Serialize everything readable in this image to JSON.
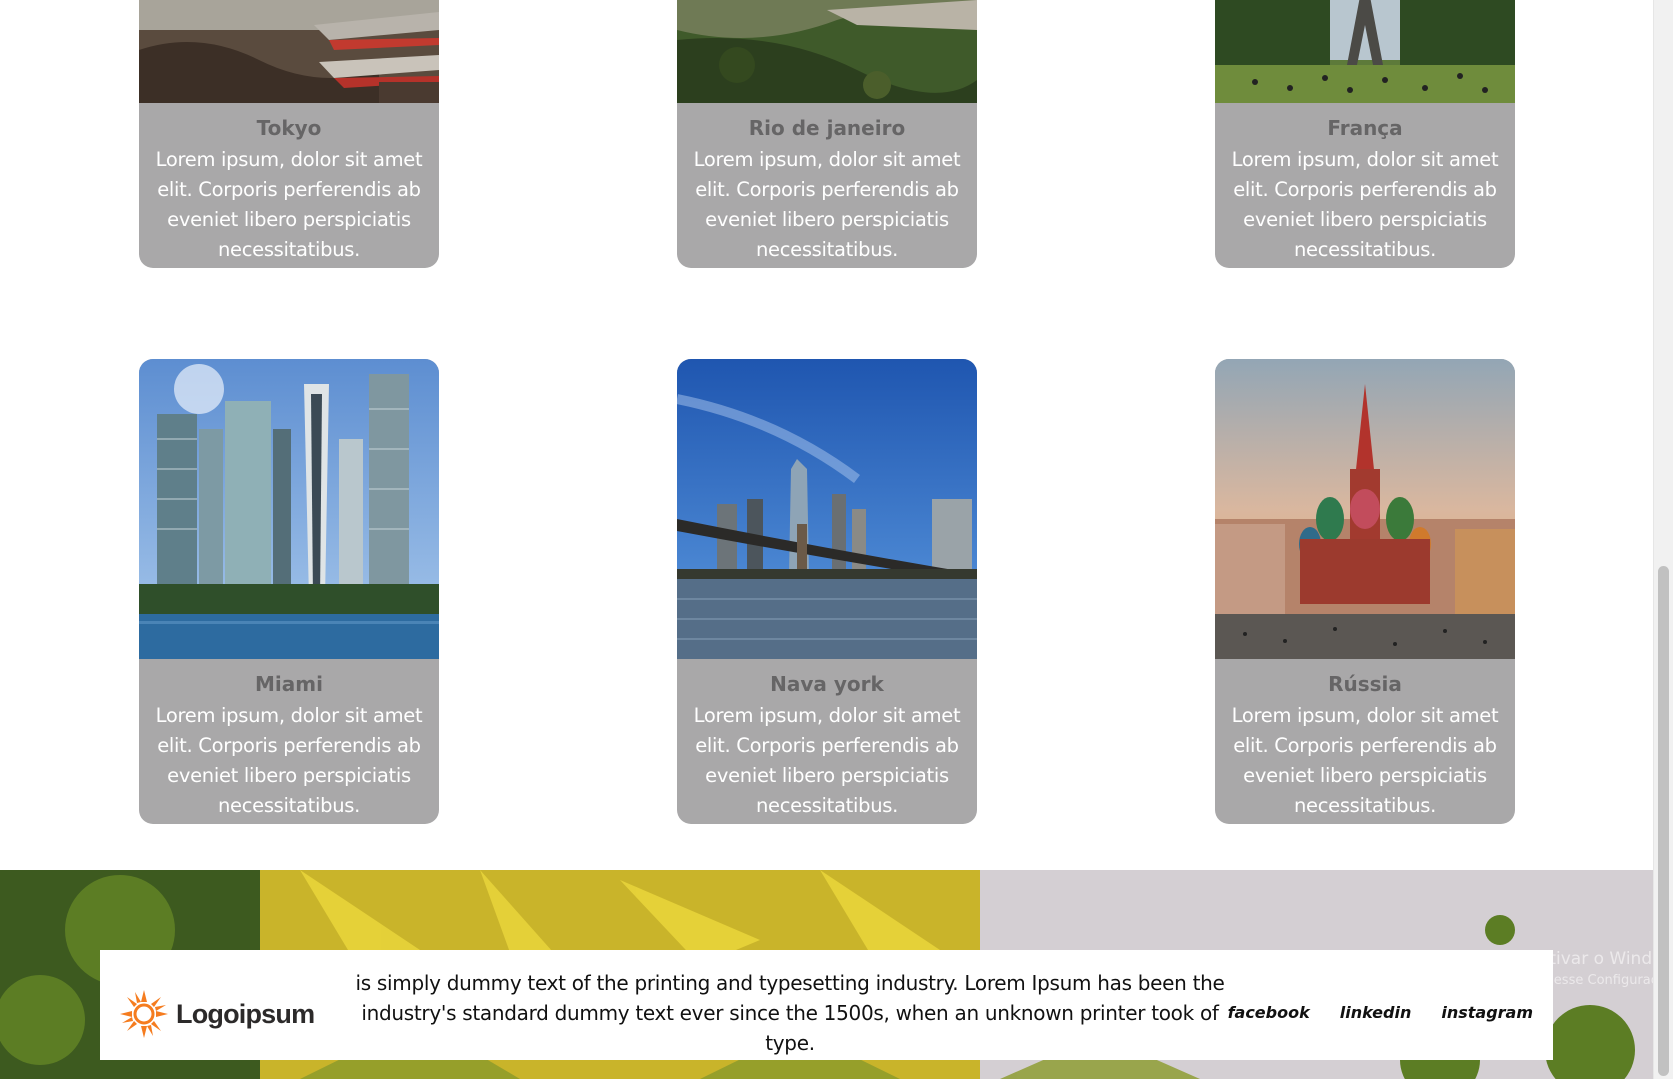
{
  "cards_top": [
    {
      "title": "Tokyo",
      "description": "Lorem ipsum, dolor sit amet elit. Corporis perferendis ab eveniet libero perspiciatis necessitatibus."
    },
    {
      "title": "Rio de janeiro",
      "description": "Lorem ipsum, dolor sit amet elit. Corporis perferendis ab eveniet libero perspiciatis necessitatibus."
    },
    {
      "title": "França",
      "description": "Lorem ipsum, dolor sit amet elit. Corporis perferendis ab eveniet libero perspiciatis necessitatibus."
    }
  ],
  "cards_bottom": [
    {
      "title": "Miami",
      "description": "Lorem ipsum, dolor sit amet elit. Corporis perferendis ab eveniet libero perspiciatis necessitatibus."
    },
    {
      "title": "Nava york",
      "description": "Lorem ipsum, dolor sit amet elit. Corporis perferendis ab eveniet libero perspiciatis necessitatibus."
    },
    {
      "title": "Rússia",
      "description": "Lorem ipsum, dolor sit amet elit. Corporis perferendis ab eveniet libero perspiciatis necessitatibus."
    }
  ],
  "footer": {
    "logo_text": "Logoipsum",
    "description": "is simply dummy text of the printing and typesetting industry. Lorem Ipsum has been the industry's standard dummy text ever since the 1500s, when an unknown printer took of type.",
    "social": [
      "facebook",
      "linkedin",
      "instagram"
    ]
  },
  "watermark": {
    "line1": "Ativar o Windows",
    "line2": "Acesse Configurações"
  },
  "colors": {
    "card_bg": "#a9a8a9",
    "card_title": "#666566",
    "logo_orange": "#f57c1f"
  }
}
